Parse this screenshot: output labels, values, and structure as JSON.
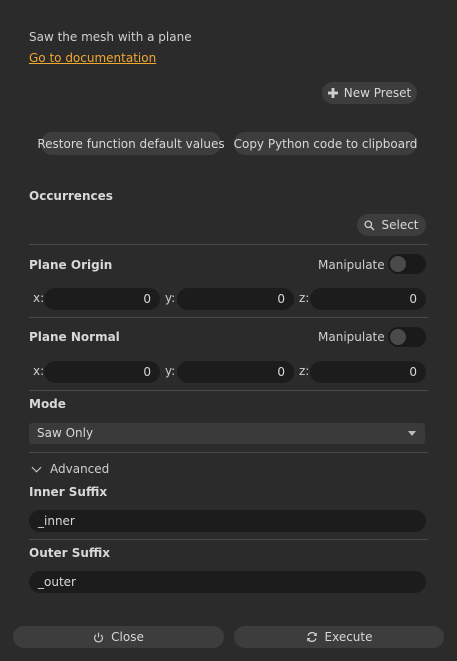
{
  "description": "Saw the mesh with a plane",
  "doc_link": "Go to documentation",
  "preset": {
    "new_preset_label": "New Preset",
    "icon": "plus-icon"
  },
  "actions": {
    "restore_label": "Restore function default values",
    "copy_python_label": "Copy Python code to clipboard"
  },
  "occurrences": {
    "label": "Occurrences",
    "select_label": "Select",
    "select_icon": "search-icon"
  },
  "plane_origin": {
    "label": "Plane Origin",
    "manipulate_label": "Manipulate",
    "manipulate_on": false,
    "x_label": "x:",
    "x": "0",
    "y_label": "y:",
    "y": "0",
    "z_label": "z:",
    "z": "0"
  },
  "plane_normal": {
    "label": "Plane Normal",
    "manipulate_label": "Manipulate",
    "manipulate_on": false,
    "x_label": "x:",
    "x": "0",
    "y_label": "y:",
    "y": "0",
    "z_label": "z:",
    "z": "0"
  },
  "mode": {
    "label": "Mode",
    "selected": "Saw Only"
  },
  "advanced": {
    "label": "Advanced",
    "expanded": true
  },
  "inner_suffix": {
    "label": "Inner Suffix",
    "value": "_inner"
  },
  "outer_suffix": {
    "label": "Outer Suffix",
    "value": "_outer"
  },
  "footer": {
    "close_label": "Close",
    "execute_label": "Execute",
    "close_icon": "power-icon",
    "execute_icon": "refresh-icon"
  },
  "colors": {
    "accent_link": "#f0a830",
    "background": "#2b2b2b",
    "field": "#1c1c1c",
    "button": "#3d3d3d"
  }
}
